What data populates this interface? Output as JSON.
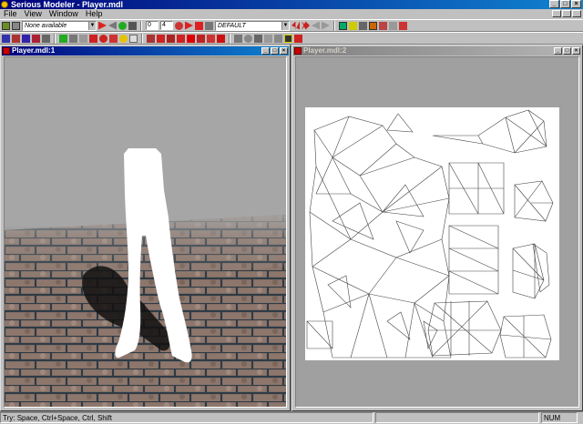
{
  "window": {
    "title": "Serious Modeler - Player.mdl"
  },
  "menu": {
    "items": [
      "File",
      "View",
      "Window",
      "Help"
    ]
  },
  "toolbar": {
    "animation_combo": "None available",
    "frame_from": "0",
    "frame_to": "4",
    "skin_combo": "DEFAULT"
  },
  "child_windows": [
    {
      "title": "Player.mdl:1",
      "active": true,
      "view": "3d-perspective"
    },
    {
      "title": "Player.mdl:2",
      "active": false,
      "view": "uv-mapping"
    }
  ],
  "statusbar": {
    "hint": "Try: Space, Ctrl+Space, Ctrl, Shift",
    "indicator": "NUM"
  },
  "colors": {
    "title_active": "#00007b",
    "title_inactive": "#808080",
    "face": "#c0c0c0",
    "floor": "#8a7266",
    "uv_lines": "#444444"
  },
  "icons": [
    "app-icon",
    "open-icon",
    "save-icon",
    "animation-add-icon",
    "animation-remove-icon",
    "play-icon",
    "stop-icon",
    "first-frame-icon",
    "last-frame-icon",
    "prev-frame-icon",
    "next-frame-icon",
    "light-icon",
    "color-icon",
    "render-mode-icon",
    "texture-icon",
    "wireframe-icon",
    "mapping-icon",
    "surface-icon"
  ]
}
